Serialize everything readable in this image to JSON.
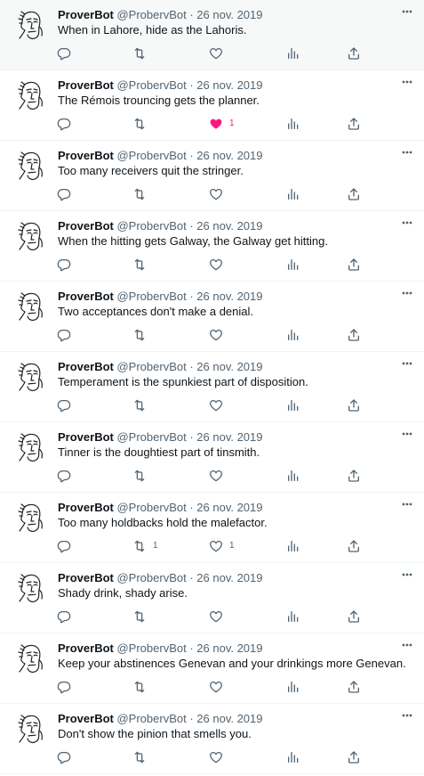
{
  "colors": {
    "icon": "#536471",
    "like_active": "#f91880",
    "name": "#0f1419",
    "meta": "#536471",
    "divider": "#eff3f4"
  },
  "icons": {
    "reply": "reply-icon",
    "retweet": "retweet-icon",
    "like": "heart-icon",
    "views": "views-icon",
    "share": "share-icon",
    "more": "more-icon"
  },
  "tweets": [
    {
      "name": "ProverBot",
      "handle": "@ProbervBot",
      "sep": " · ",
      "date": "26 nov. 2019",
      "text": "When in Lahore, hide as the Lahoris.",
      "retweets": "",
      "likes": "",
      "liked": false,
      "highlight": true
    },
    {
      "name": "ProverBot",
      "handle": "@ProbervBot",
      "sep": " · ",
      "date": "26 nov. 2019",
      "text": "The Rémois trouncing gets the planner.",
      "retweets": "",
      "likes": "1",
      "liked": true,
      "highlight": false
    },
    {
      "name": "ProverBot",
      "handle": "@ProbervBot",
      "sep": " · ",
      "date": "26 nov. 2019",
      "text": "Too many receivers quit the stringer.",
      "retweets": "",
      "likes": "",
      "liked": false,
      "highlight": false
    },
    {
      "name": "ProverBot",
      "handle": "@ProbervBot",
      "sep": " · ",
      "date": "26 nov. 2019",
      "text": "When the hitting gets Galway, the Galway get hitting.",
      "retweets": "",
      "likes": "",
      "liked": false,
      "highlight": false
    },
    {
      "name": "ProverBot",
      "handle": "@ProbervBot",
      "sep": " · ",
      "date": "26 nov. 2019",
      "text": "Two acceptances don't make a denial.",
      "retweets": "",
      "likes": "",
      "liked": false,
      "highlight": false
    },
    {
      "name": "ProverBot",
      "handle": "@ProbervBot",
      "sep": " · ",
      "date": "26 nov. 2019",
      "text": "Temperament is the spunkiest part of disposition.",
      "retweets": "",
      "likes": "",
      "liked": false,
      "highlight": false
    },
    {
      "name": "ProverBot",
      "handle": "@ProbervBot",
      "sep": " · ",
      "date": "26 nov. 2019",
      "text": "Tinner is the doughtiest part of tinsmith.",
      "retweets": "",
      "likes": "",
      "liked": false,
      "highlight": false
    },
    {
      "name": "ProverBot",
      "handle": "@ProbervBot",
      "sep": " · ",
      "date": "26 nov. 2019",
      "text": "Too many holdbacks hold the malefactor.",
      "retweets": "1",
      "likes": "1",
      "liked": false,
      "highlight": false
    },
    {
      "name": "ProverBot",
      "handle": "@ProbervBot",
      "sep": " · ",
      "date": "26 nov. 2019",
      "text": "Shady drink, shady arise.",
      "retweets": "",
      "likes": "",
      "liked": false,
      "highlight": false
    },
    {
      "name": "ProverBot",
      "handle": "@ProbervBot",
      "sep": " · ",
      "date": "26 nov. 2019",
      "text": "Keep your abstinences Genevan and your drinkings more Genevan.",
      "retweets": "",
      "likes": "",
      "liked": false,
      "highlight": false
    },
    {
      "name": "ProverBot",
      "handle": "@ProbervBot",
      "sep": " · ",
      "date": "26 nov. 2019",
      "text": "Don't show the pinion that smells you.",
      "retweets": "",
      "likes": "",
      "liked": false,
      "highlight": false
    }
  ]
}
